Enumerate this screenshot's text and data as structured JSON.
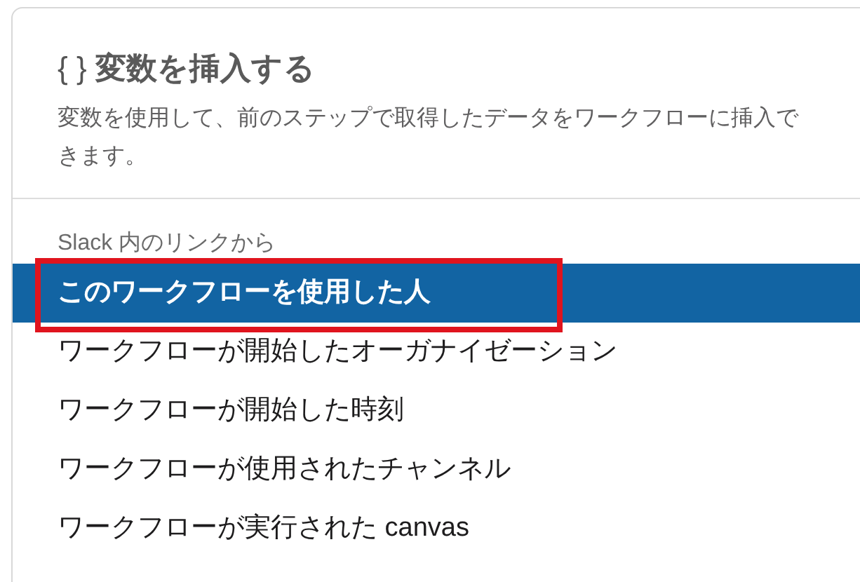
{
  "header": {
    "icon_text": "{ }",
    "title": "変数を挿入する",
    "description": "変数を使用して、前のステップで取得したデータをワークフローに挿入できます。"
  },
  "section": {
    "label": "Slack 内のリンクから"
  },
  "items": [
    {
      "label": "このワークフローを使用した人",
      "selected": true,
      "highlighted": true
    },
    {
      "label": "ワークフローが開始したオーガナイゼーション",
      "selected": false,
      "highlighted": false
    },
    {
      "label": "ワークフローが開始した時刻",
      "selected": false,
      "highlighted": false
    },
    {
      "label": "ワークフローが使用されたチャンネル",
      "selected": false,
      "highlighted": false
    },
    {
      "label": "ワークフローが実行された canvas",
      "selected": false,
      "highlighted": false
    }
  ]
}
